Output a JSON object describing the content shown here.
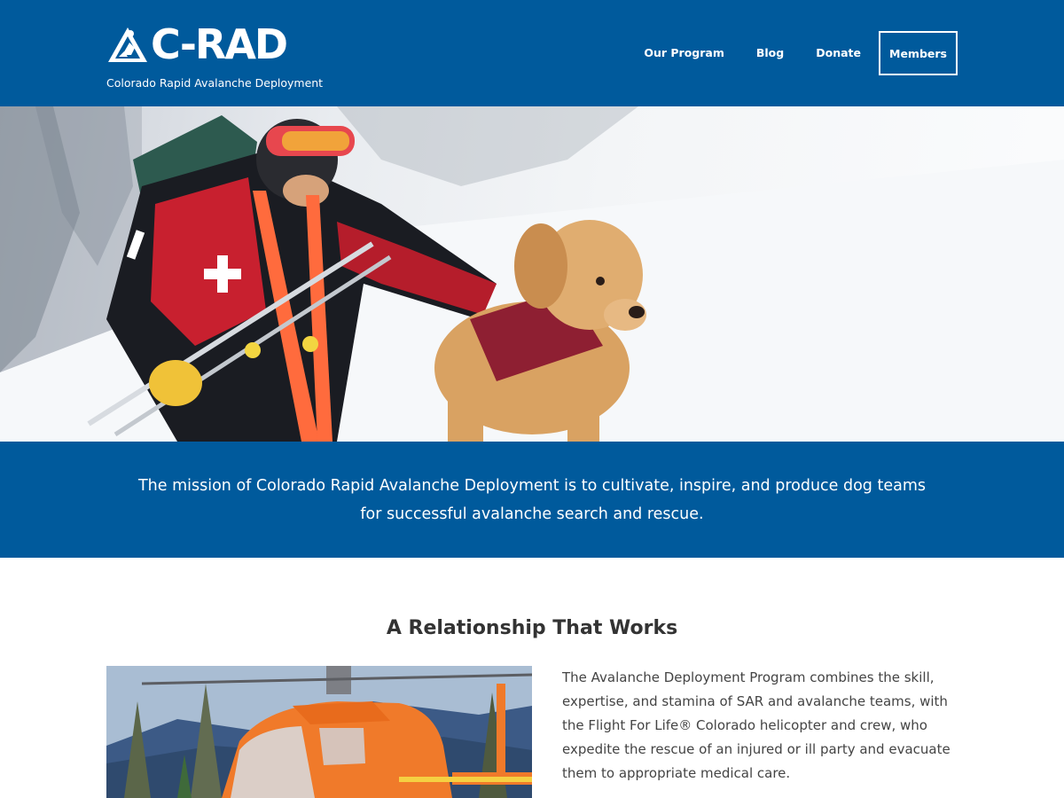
{
  "header": {
    "logo_text": "C-RAD",
    "tagline": "Colorado Rapid Avalanche Deployment",
    "nav": [
      {
        "label": "Our Program"
      },
      {
        "label": "Blog"
      },
      {
        "label": "Donate"
      }
    ],
    "members_label": "Members"
  },
  "mission": {
    "text": "The mission of Colorado Rapid Avalanche Deployment is to cultivate, inspire, and produce dog teams for successful avalanche search and rescue."
  },
  "relationship": {
    "title": "A Relationship That Works",
    "body": "The Avalanche Deployment Program combines the skill, expertise, and stamina of SAR and avalanche teams, with the Flight For Life® Colorado helicopter and crew, who expedite the rescue of an injured or ill party and evacuate them to appropriate medical care."
  },
  "colors": {
    "brand_blue": "#005a9c",
    "text_dark": "#333333",
    "text_body": "#444444",
    "white": "#ffffff"
  },
  "icons": {
    "logo": "mountain-rescuer-icon"
  }
}
